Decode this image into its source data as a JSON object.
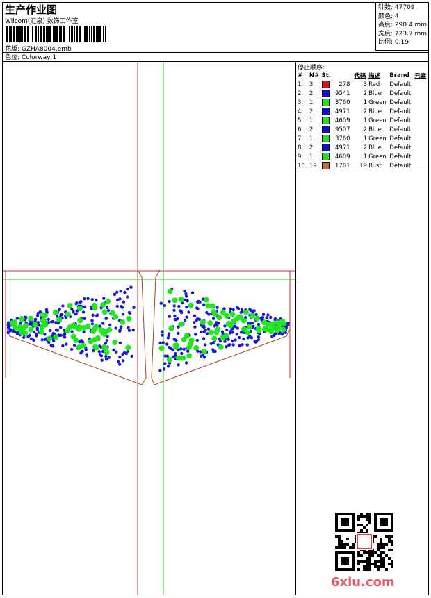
{
  "header": {
    "title": "生产作业图",
    "studio": "Wilcom(汇泉) 数饰工作室",
    "file_name": "花版:  GZHA8004.emb",
    "colorway": "色位:  Colorway 1",
    "stats": [
      {
        "label": "针数:",
        "value": "47709"
      },
      {
        "label": "颜色:",
        "value": "4"
      },
      {
        "label": "高度:",
        "value": "290.4 mm"
      },
      {
        "label": "宽度:",
        "value": "723.7 mm"
      },
      {
        "label": "比例:",
        "value": "0.19"
      }
    ]
  },
  "sequence": {
    "title": "停止顺序:",
    "headers": [
      "#",
      "N#",
      "St.",
      "代码",
      "描述",
      "Brand",
      "元素"
    ],
    "rows": [
      {
        "n": "1.",
        "needle": "3",
        "color": "#e01010",
        "st": "278",
        "code": "3",
        "desc": "Red",
        "brand": "Default"
      },
      {
        "n": "2.",
        "needle": "2",
        "color": "#1010d0",
        "st": "9541",
        "code": "2",
        "desc": "Blue",
        "brand": "Default"
      },
      {
        "n": "3.",
        "needle": "1",
        "color": "#20e020",
        "st": "3760",
        "code": "1",
        "desc": "Green",
        "brand": "Default"
      },
      {
        "n": "4.",
        "needle": "2",
        "color": "#1010d0",
        "st": "4971",
        "code": "2",
        "desc": "Blue",
        "brand": "Default"
      },
      {
        "n": "5.",
        "needle": "1",
        "color": "#20e020",
        "st": "4609",
        "code": "1",
        "desc": "Green",
        "brand": "Default"
      },
      {
        "n": "6.",
        "needle": "2",
        "color": "#1010d0",
        "st": "9507",
        "code": "2",
        "desc": "Blue",
        "brand": "Default"
      },
      {
        "n": "7.",
        "needle": "1",
        "color": "#20e020",
        "st": "3760",
        "code": "1",
        "desc": "Green",
        "brand": "Default"
      },
      {
        "n": "8.",
        "needle": "2",
        "color": "#1010d0",
        "st": "4971",
        "code": "2",
        "desc": "Blue",
        "brand": "Default"
      },
      {
        "n": "9.",
        "needle": "1",
        "color": "#20e020",
        "st": "4609",
        "code": "1",
        "desc": "Green",
        "brand": "Default"
      },
      {
        "n": "10.",
        "needle": "19",
        "color": "#c86a3a",
        "st": "1701",
        "code": "19",
        "desc": "Rust",
        "brand": "Default"
      }
    ]
  },
  "watermark": "6xiu.com"
}
